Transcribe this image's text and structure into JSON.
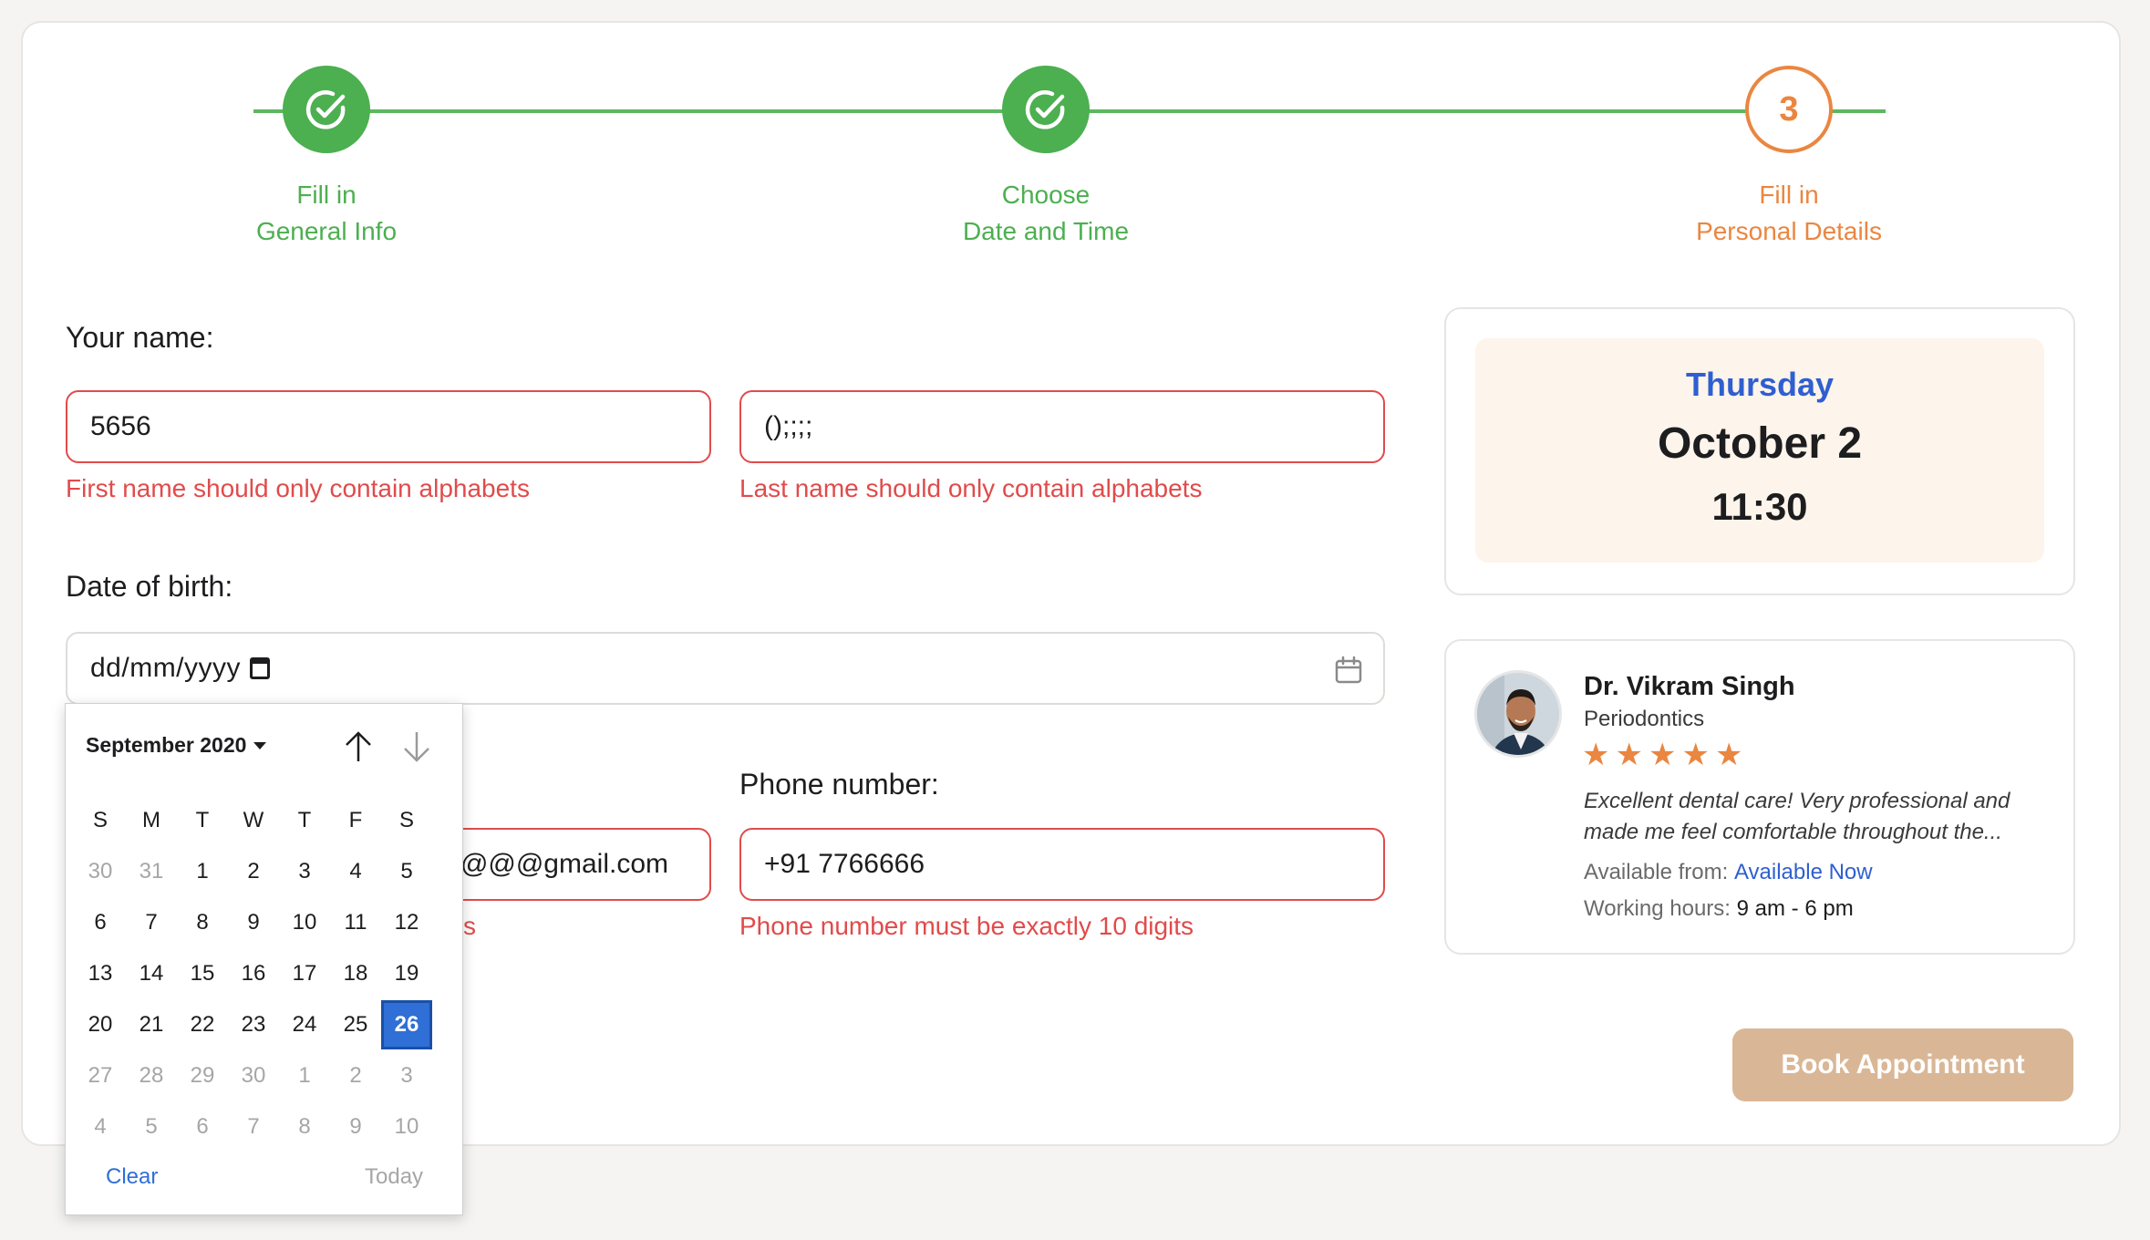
{
  "stepper": {
    "steps": [
      {
        "line1": "Fill in",
        "line2": "General Info",
        "state": "done"
      },
      {
        "line1": "Choose",
        "line2": "Date and Time",
        "state": "done"
      },
      {
        "line1": "Fill in",
        "line2": "Personal Details",
        "state": "current",
        "number": "3"
      }
    ]
  },
  "form": {
    "name_label": "Your name:",
    "first_name_value": "5656",
    "last_name_value": "();;;;",
    "first_name_error": "First name should only contain alphabets",
    "last_name_error": "Last name should only contain alphabets",
    "dob_label": "Date of birth:",
    "dob_placeholder": "dd/mm/yyyy",
    "email_value_visible": "@@@gmail.com",
    "email_error_visible": "s",
    "phone_label": "Phone number:",
    "phone_value": "+91 7766666",
    "phone_error": "Phone number must be exactly 10 digits"
  },
  "appointment": {
    "weekday": "Thursday",
    "date": "October 2",
    "time": "11:30"
  },
  "doctor": {
    "name": "Dr. Vikram Singh",
    "specialty": "Periodontics",
    "rating": 5,
    "review": "Excellent dental care! Very professional and made me feel comfortable throughout the...",
    "review_line1": "Excellent dental care! Very professional and",
    "review_line2": "made me feel comfortable throughout the...",
    "available_label": "Available from:",
    "available_value": "Available Now",
    "hours_label": "Working hours:",
    "hours_value": "9 am - 6 pm"
  },
  "book_button": "Book Appointment",
  "calendar": {
    "month_label": "September 2020",
    "weekday_headers": [
      "S",
      "M",
      "T",
      "W",
      "T",
      "F",
      "S"
    ],
    "weeks": [
      [
        [
          "30",
          true
        ],
        [
          "31",
          true
        ],
        [
          "1",
          false
        ],
        [
          "2",
          false
        ],
        [
          "3",
          false
        ],
        [
          "4",
          false
        ],
        [
          "5",
          false
        ]
      ],
      [
        [
          "6",
          false
        ],
        [
          "7",
          false
        ],
        [
          "8",
          false
        ],
        [
          "9",
          false
        ],
        [
          "10",
          false
        ],
        [
          "11",
          false
        ],
        [
          "12",
          false
        ]
      ],
      [
        [
          "13",
          false
        ],
        [
          "14",
          false
        ],
        [
          "15",
          false
        ],
        [
          "16",
          false
        ],
        [
          "17",
          false
        ],
        [
          "18",
          false
        ],
        [
          "19",
          false
        ]
      ],
      [
        [
          "20",
          false
        ],
        [
          "21",
          false
        ],
        [
          "22",
          false
        ],
        [
          "23",
          false
        ],
        [
          "24",
          false
        ],
        [
          "25",
          false
        ],
        [
          "26",
          false
        ]
      ],
      [
        [
          "27",
          true
        ],
        [
          "28",
          true
        ],
        [
          "29",
          true
        ],
        [
          "30",
          true
        ],
        [
          "1",
          true
        ],
        [
          "2",
          true
        ],
        [
          "3",
          true
        ]
      ],
      [
        [
          "4",
          true
        ],
        [
          "5",
          true
        ],
        [
          "6",
          true
        ],
        [
          "7",
          true
        ],
        [
          "8",
          true
        ],
        [
          "9",
          true
        ],
        [
          "10",
          true
        ]
      ]
    ],
    "selected_day": "26",
    "clear_label": "Clear",
    "today_label": "Today"
  },
  "colors": {
    "done": "#4caf50",
    "current": "#ea8640",
    "error": "#e14b4b",
    "accent_blue": "#2f5fd0",
    "star": "#ea8640",
    "button": "#d9b796"
  }
}
